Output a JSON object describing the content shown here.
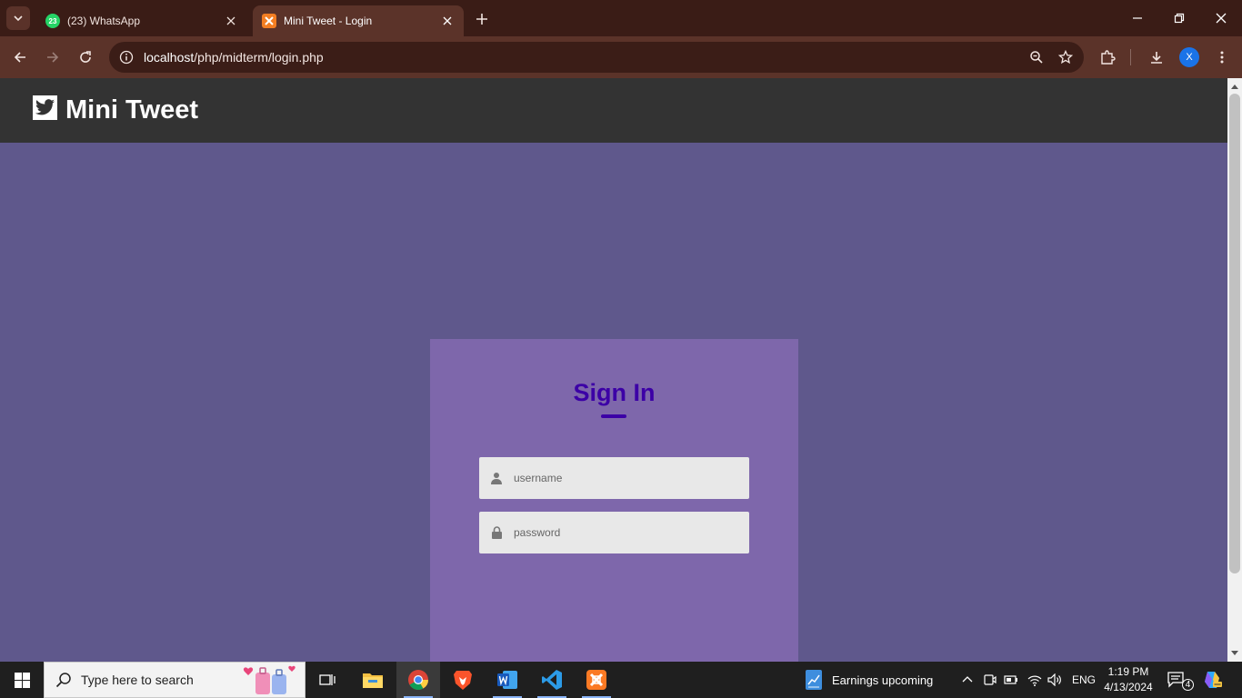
{
  "browser": {
    "tabs": [
      {
        "title": "(23) WhatsApp",
        "badge": "23",
        "active": false
      },
      {
        "title": "Mini Tweet - Login",
        "active": true
      }
    ],
    "url_host": "localhost",
    "url_path": "/php/midterm/login.php",
    "profile_initial": "X"
  },
  "page": {
    "brand_name": "Mini Tweet",
    "signin_title": "Sign In",
    "username_placeholder": "username",
    "password_placeholder": "password",
    "colors": {
      "header_bg": "#333333",
      "page_bg": "#5f588c",
      "card_bg": "#7e67ab",
      "title_color": "#3c00a6"
    }
  },
  "taskbar": {
    "search_placeholder": "Type here to search",
    "weather_text": "Earnings upcoming",
    "language": "ENG",
    "time": "1:19 PM",
    "date": "4/13/2024",
    "notification_count": "4"
  }
}
